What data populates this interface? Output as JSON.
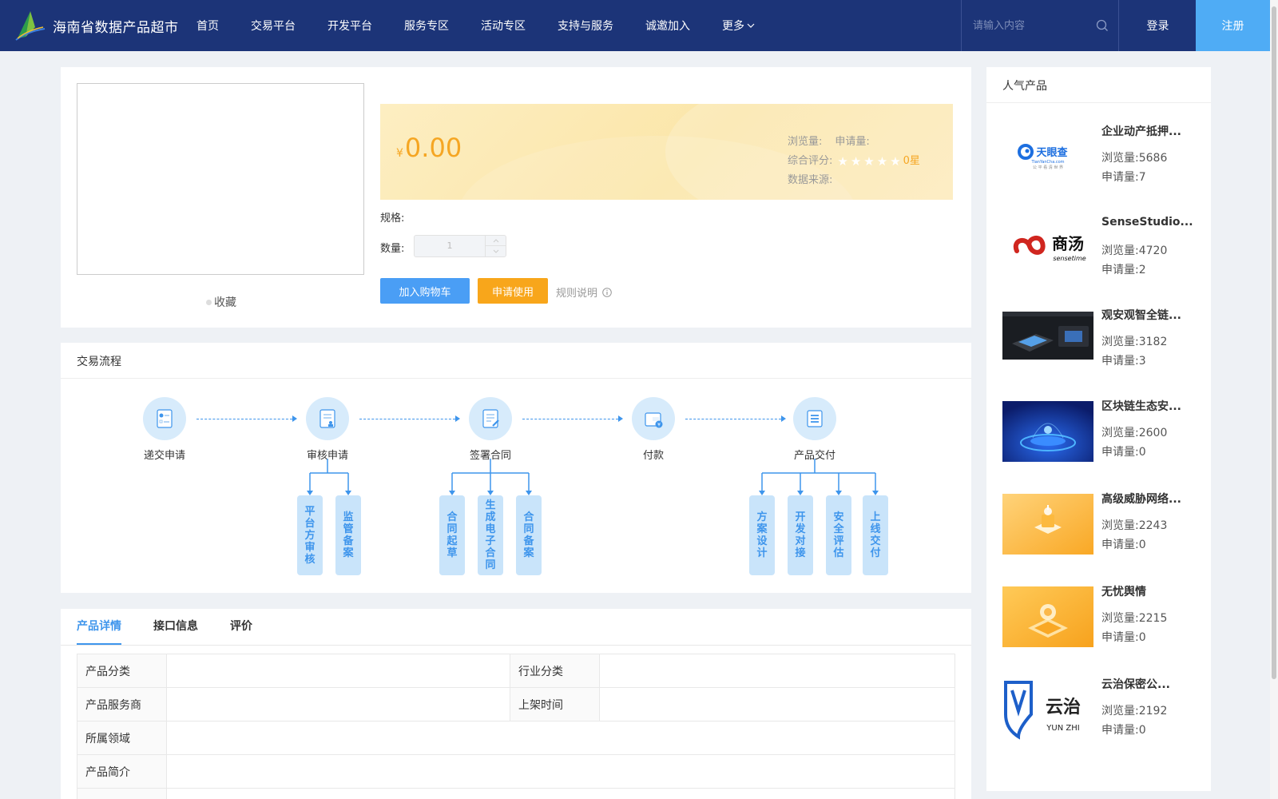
{
  "header": {
    "site_title": "海南省数据产品超市",
    "nav": [
      "首页",
      "交易平台",
      "开发平台",
      "服务专区",
      "活动专区",
      "支持与服务",
      "诚邀加入"
    ],
    "nav_more": "更多",
    "search_placeholder": "请输入内容",
    "login": "登录",
    "register": "注册"
  },
  "product": {
    "favorite": "收藏",
    "currency": "¥",
    "price": "0.00",
    "views_label": "浏览量:",
    "applies_label": "申请量:",
    "rating_label": "综合评分:",
    "rating_value": "0星",
    "rating_stars": 0,
    "source_label": "数据来源:",
    "spec_label": "规格:",
    "qty_label": "数量:",
    "qty_value": "1",
    "add_cart": "加入购物车",
    "apply": "申请使用",
    "rules": "规则说明"
  },
  "process": {
    "title": "交易流程",
    "steps": [
      "递交申请",
      "审核申请",
      "签署合同",
      "付款",
      "产品交付"
    ],
    "sub_steps": {
      "review": [
        "平台方审核",
        "监管备案"
      ],
      "contract": [
        "合同起草",
        "生成电子合同",
        "合同备案"
      ],
      "delivery": [
        "方案设计",
        "开发对接",
        "安全评估",
        "上线交付"
      ]
    }
  },
  "details": {
    "tabs": [
      "产品详情",
      "接口信息",
      "评价"
    ],
    "active_tab": 0,
    "rows": [
      {
        "label": "产品分类",
        "value": "",
        "label2": "行业分类",
        "value2": ""
      },
      {
        "label": "产品服务商",
        "value": "",
        "label2": "上架时间",
        "value2": ""
      },
      {
        "label": "所属领域",
        "value": ""
      },
      {
        "label": "产品简介",
        "value": ""
      }
    ]
  },
  "popular": {
    "title": "人气产品",
    "views_label": "浏览量:",
    "applies_label": "申请量:",
    "items": [
      {
        "name": "企业动产抵押...",
        "views": "5686",
        "applies": "7",
        "thumb": "tianyancha-logo"
      },
      {
        "name": "SenseStudio...",
        "views": "4720",
        "applies": "2",
        "thumb": "sensetime-logo"
      },
      {
        "name": "观安观智全链...",
        "views": "3182",
        "applies": "3",
        "thumb": "dashboard-device-image"
      },
      {
        "name": "区块链生态安...",
        "views": "2600",
        "applies": "0",
        "thumb": "blockchain-platform-image"
      },
      {
        "name": "高级威胁网络...",
        "views": "2243",
        "applies": "0",
        "thumb": "threat-network-image"
      },
      {
        "name": "无忧舆情",
        "views": "2215",
        "applies": "0",
        "thumb": "sentiment-image"
      },
      {
        "name": "云治保密公...",
        "views": "2192",
        "applies": "0",
        "thumb": "yunzhi-logo"
      }
    ],
    "logo_text": {
      "tianyancha": "天眼查",
      "tianyancha_sub": "TianYanCha.com",
      "tianyancha_tagline": "公 平 看 清 世 界",
      "sensetime_cn": "商汤",
      "sensetime_en": "sensetime",
      "yunzhi_cn": "云治",
      "yunzhi_en": "YUN ZHI"
    }
  },
  "colors": {
    "header_bg": "#1c3478",
    "primary": "#3e95ec",
    "accent": "#f8a61b",
    "register_bg": "#4facf5"
  }
}
